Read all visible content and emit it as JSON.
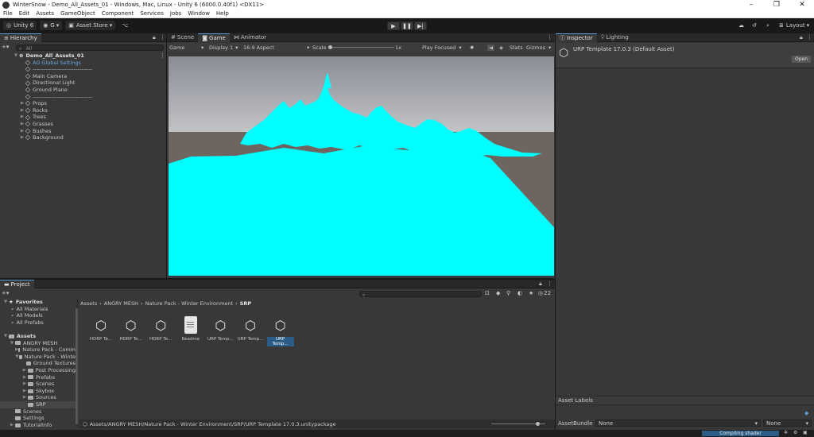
{
  "window": {
    "title": "WinterSnow - Demo_All_Assets_01 - Windows, Mac, Linux - Unity 6 (6000.0.40f1) <DX11>"
  },
  "menu": [
    "File",
    "Edit",
    "Assets",
    "GameObject",
    "Component",
    "Services",
    "Jobs",
    "Window",
    "Help"
  ],
  "toolbar": {
    "unity": "Unity 6",
    "account": "G",
    "asset_store": "Asset Store",
    "layout": "Layout"
  },
  "hierarchy": {
    "tab": "Hierarchy",
    "search_placeholder": "All",
    "scene": "Demo_All_Assets_01",
    "items": [
      {
        "label": "AG Global Settings",
        "indent": 1,
        "fold": false,
        "selected": true
      },
      {
        "label": "--------------------------------",
        "indent": 1,
        "fold": false
      },
      {
        "label": "Main Camera",
        "indent": 1,
        "fold": false
      },
      {
        "label": "Directional Light",
        "indent": 1,
        "fold": false
      },
      {
        "label": "Ground Plane",
        "indent": 1,
        "fold": false
      },
      {
        "label": "--------------------------------",
        "indent": 1,
        "fold": false
      },
      {
        "label": "Props",
        "indent": 1,
        "fold": true
      },
      {
        "label": "Rocks",
        "indent": 1,
        "fold": true
      },
      {
        "label": "Trees",
        "indent": 1,
        "fold": true
      },
      {
        "label": "Grasses",
        "indent": 1,
        "fold": true
      },
      {
        "label": "Bushes",
        "indent": 1,
        "fold": true
      },
      {
        "label": "Background",
        "indent": 1,
        "fold": true
      }
    ]
  },
  "center_tabs": {
    "scene": "Scene",
    "game": "Game",
    "animator": "Animator"
  },
  "game_toolbar": {
    "game": "Game",
    "display": "Display 1",
    "aspect": "16:9 Aspect",
    "scale_label": "Scale",
    "scale_value": "1x",
    "play_mode": "Play Focused",
    "stats": "Stats",
    "gizmos": "Gizmos"
  },
  "inspector": {
    "tab": "Inspector",
    "lighting_tab": "Lighting",
    "asset_title": "URP Template 17.0.3 (Default Asset)",
    "open_button": "Open",
    "asset_labels": "Asset Labels",
    "asset_bundle_label": "AssetBundle",
    "bundle_value": "None",
    "variant_value": "None"
  },
  "project": {
    "tab": "Project",
    "search_count": "22",
    "breadcrumb": [
      "Assets",
      "ANGRY MESH",
      "Nature Pack - Winter Environment",
      "SRP"
    ],
    "favorites": {
      "label": "Favorites",
      "items": [
        "All Materials",
        "All Models",
        "All Prefabs"
      ]
    },
    "tree": [
      {
        "label": "Assets",
        "indent": 0,
        "fold": "open"
      },
      {
        "label": "ANGRY MESH",
        "indent": 1,
        "fold": "open"
      },
      {
        "label": "Nature Pack - Comm",
        "indent": 2,
        "fold": "closed"
      },
      {
        "label": "Nature Pack - Winte",
        "indent": 2,
        "fold": "open"
      },
      {
        "label": "Ground Textures",
        "indent": 3,
        "fold": "none"
      },
      {
        "label": "Post Processing",
        "indent": 3,
        "fold": "closed"
      },
      {
        "label": "Prefabs",
        "indent": 3,
        "fold": "closed"
      },
      {
        "label": "Scenes",
        "indent": 3,
        "fold": "closed"
      },
      {
        "label": "Skybox",
        "indent": 3,
        "fold": "closed"
      },
      {
        "label": "Sources",
        "indent": 3,
        "fold": "closed"
      },
      {
        "label": "SRP",
        "indent": 3,
        "fold": "none",
        "selected": true
      },
      {
        "label": "Scenes",
        "indent": 1,
        "fold": "none"
      },
      {
        "label": "Settings",
        "indent": 1,
        "fold": "none"
      },
      {
        "label": "TutorialInfo",
        "indent": 1,
        "fold": "closed"
      }
    ],
    "assets": [
      {
        "label": "HDRP Te...",
        "type": "unity"
      },
      {
        "label": "HDRP Te...",
        "type": "unity"
      },
      {
        "label": "HDRP Te...",
        "type": "unity"
      },
      {
        "label": "Readme",
        "type": "doc"
      },
      {
        "label": "URP Temp...",
        "type": "unity"
      },
      {
        "label": "URP Temp...",
        "type": "unity"
      },
      {
        "label": "URP Temp...",
        "type": "unity",
        "selected": true
      }
    ],
    "status_path": "Assets/ANGRY MESH/Nature Pack - Winter Environment/SRP/URP Template 17.0.3.unitypackage"
  },
  "status": {
    "compiling": "Compiling shader"
  },
  "colors": {
    "scene_cyan": "#00ffff",
    "sky_top": "#8a8d96",
    "sky_bottom": "#c8c9cb",
    "ground": "#6e6560",
    "selection": "#2c5d87",
    "accent": "#5a9bd5"
  }
}
